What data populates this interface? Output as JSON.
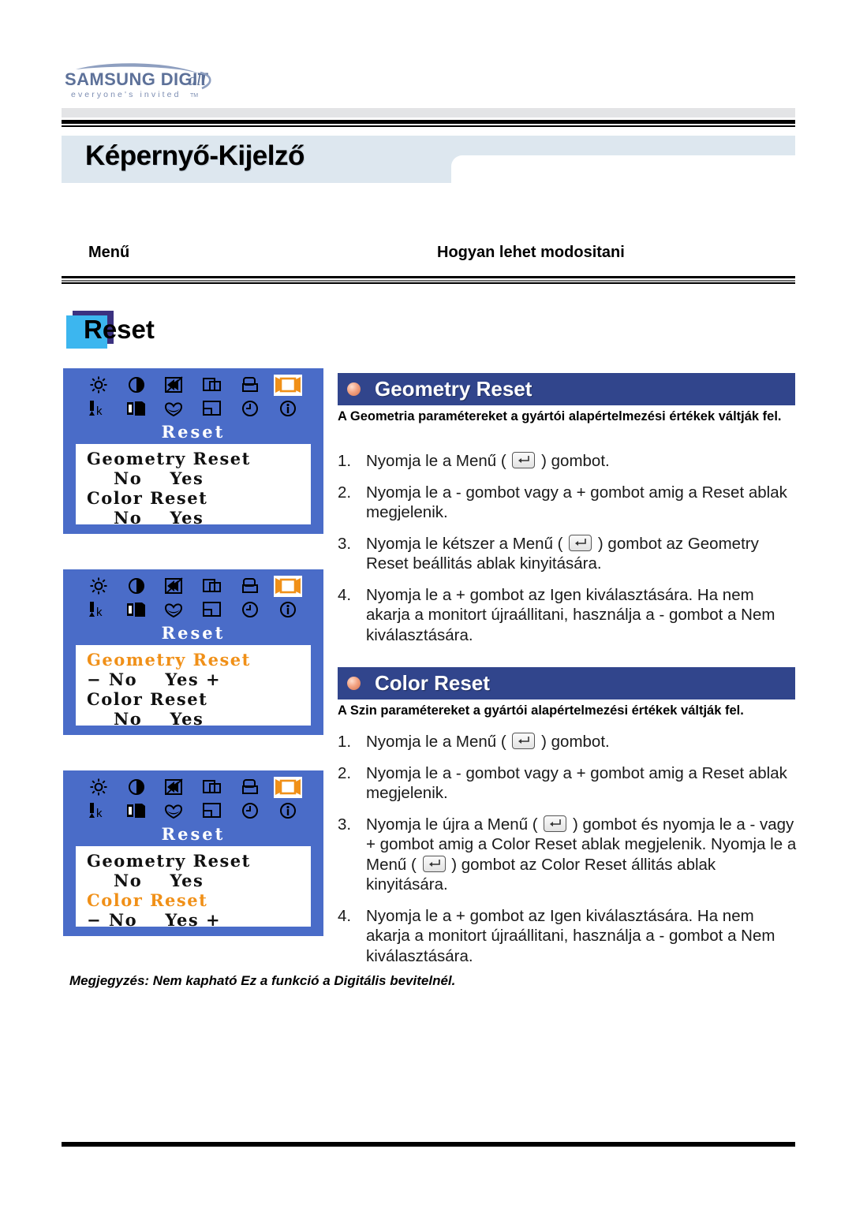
{
  "brand": {
    "logo_main": "SAMSUNG DIGITall",
    "logo_tagline": "everyone's invited",
    "logo_tm": "TM",
    "logo_color": "#6b7fa8"
  },
  "header": {
    "page_title": "Képernyő-Kijelző",
    "band_color": "#dde7ef"
  },
  "columns": {
    "menu_label": "Menű",
    "howto_label": "Hogyan lehet modositani"
  },
  "section": {
    "label": "Reset",
    "box_color": "#3cb6ef",
    "shadow_color": "#3b3280"
  },
  "osd_shots": [
    {
      "name": "reset-menu-overview",
      "title": "Reset",
      "rows": [
        {
          "text": "Geometry Reset",
          "style": "label",
          "highlight": false
        },
        {
          "text": "No    Yes",
          "style": "options",
          "highlight": false
        },
        {
          "text": "Color Reset",
          "style": "label",
          "highlight": false
        },
        {
          "text": "No    Yes",
          "style": "options",
          "highlight": false
        }
      ]
    },
    {
      "name": "geometry-reset-selected",
      "title": "Reset",
      "rows": [
        {
          "text": "Geometry Reset",
          "style": "label",
          "highlight": true
        },
        {
          "text": "− No    Yes +",
          "style": "options-active",
          "highlight": false
        },
        {
          "text": "Color Reset",
          "style": "label",
          "highlight": false
        },
        {
          "text": "No    Yes",
          "style": "options",
          "highlight": false
        }
      ]
    },
    {
      "name": "color-reset-selected",
      "title": "Reset",
      "rows": [
        {
          "text": "Geometry Reset",
          "style": "label",
          "highlight": false
        },
        {
          "text": "No    Yes",
          "style": "options",
          "highlight": false
        },
        {
          "text": "Color Reset",
          "style": "label",
          "highlight": true
        },
        {
          "text": "− No    Yes +",
          "style": "options-active",
          "highlight": false
        }
      ]
    }
  ],
  "osd_icons": {
    "row1": [
      "brightness-icon",
      "contrast-icon",
      "image-lock-icon",
      "h-position-icon",
      "v-position-icon",
      "reset-icon"
    ],
    "row2": [
      "color-temperature-icon",
      "color-control-icon",
      "image-sharpness-icon",
      "osd-position-icon",
      "osd-timer-icon",
      "information-icon"
    ],
    "selected_icon": "reset-icon",
    "bg_color": "#4a6cc8",
    "highlight_color": "#f09018"
  },
  "sections": {
    "geometry": {
      "heading": "Geometry Reset",
      "description": "A Geometria paramétereket a gyártói alapértelmezési értékek váltják fel.",
      "steps": [
        {
          "num": "1.",
          "pre": "Nyomja le a Menű  ( ",
          "post": " ) gombot.",
          "has_key": true
        },
        {
          "num": "2.",
          "pre": "Nyomja le a - gombot vagy a + gombot amig a Reset ablak megjelenik.",
          "post": "",
          "has_key": false
        },
        {
          "num": "3.",
          "pre": "Nyomja le kétszer a Menű ( ",
          "post": " ) gombot az Geometry Reset beállitás ablak kinyitására.",
          "has_key": true
        },
        {
          "num": "4.",
          "pre": "Nyomja le a + gombot az Igen kiválasztására. Ha nem akarja a monitort újraállitani, használja a - gombot a Nem kiválasztására.",
          "post": "",
          "has_key": false
        }
      ]
    },
    "color": {
      "heading": "Color Reset",
      "description": "A Szin paramétereket a gyártói alapértelmezési értékek váltják fel.",
      "steps": [
        {
          "num": "1.",
          "pre": "Nyomja le a Menű  ( ",
          "post": " ) gombot.",
          "has_key": true
        },
        {
          "num": "2.",
          "pre": "Nyomja le a - gombot vagy a + gombot amig a Reset ablak megjelenik.",
          "post": "",
          "has_key": false
        },
        {
          "num": "3.",
          "pre": "Nyomja le újra a Menű ( ",
          "mid": " ) gombot és nyomja le a - vagy + gombot amig a Color Reset ablak megjelenik. Nyomja le a Menű ( ",
          "post": " ) gombot az Color Reset állitás ablak kinyitására.",
          "has_key": true,
          "has_key2": true
        },
        {
          "num": "4.",
          "pre": "Nyomja le a + gombot az Igen kiválasztására. Ha nem akarja a monitort újraállitani, használja a - gombot a Nem kiválasztására.",
          "post": "",
          "has_key": false
        }
      ]
    }
  },
  "footnote": "Megjegyzés: Nem kapható Ez a funkció a Digitális bevitelnél.",
  "colors": {
    "bluebar": "#31458c",
    "osd_blue": "#4a6cc8",
    "osd_orange": "#f09018"
  }
}
